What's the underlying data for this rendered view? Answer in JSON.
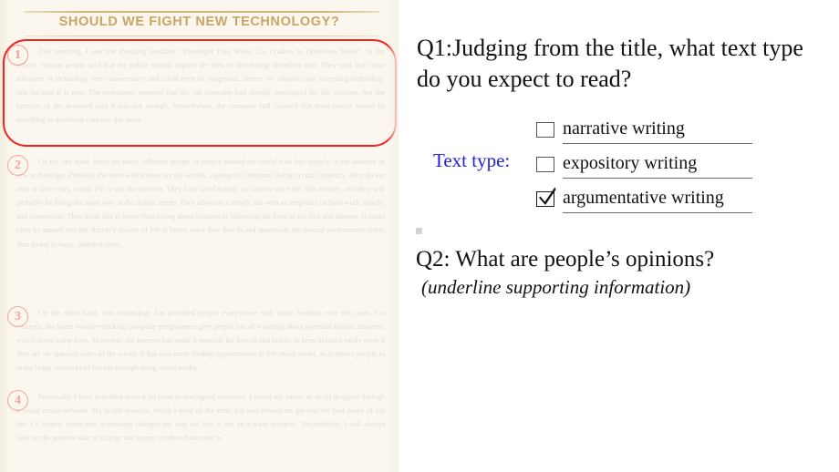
{
  "document": {
    "title": "SHOULD WE FIGHT NEW TECHNOLOGY?",
    "title_color": "#c9a566",
    "page_background": "#fbf7ee",
    "highlight_color": "#f4241c",
    "paragraph_number_color": "#f3a6a0",
    "paragraph_numbers": [
      "1",
      "2",
      "3",
      "4"
    ],
    "paragraphs": [
      {
        "number": "1",
        "highlighted": true,
        "text": "This morning, I saw the shocking headline: “Passenger Dies When Car Crashes in Driverless Mode”. In the article, various people said that the public should oppose the idea of developing driverless cars. They said that some advances in technology were unnecessary and could even be dangerous. Hence, we should cease accepting technology just because it is new. The newspaper reported that the car company had already apologised for the accident, but the families of the deceased said it was not enough. Nevertheless, the company still claimed that most people would be travelling in driverless cars one day soon."
      },
      {
        "number": "2",
        "highlighted": false,
        "text": "On the one hand, there are many different groups of people around the world who live happily in the absence of new technology. Probably the most well known are the Amish, a group of Christians living in rural America. They do not own or drive cars, watch TV, or use the Internet. They have lived mainly as farmers since the 18th century, and they will probably be living the same way in the distant future. They advocate a simple life with an emphasis on hard work, family, and community. They think that is better than caring about luxuries or following the lives of the rich and famous. It could even be argued that the Amish’s quality of life is better since they live in and appreciate the natural environment rather than living in large, polluted cities."
      },
      {
        "number": "3",
        "highlighted": false,
        "text": "On the other hand, new technology has provided people everywhere with many benefits over the years. For example, the latest weather-tracking computer programmes give people lots of warnings about potential natural disasters, which saves many lives. Moreover, the Internet has made it possible for friends and family to keep in touch easily even if they are on opposite sides of the world. It has also made finding opportunities in life much easier, as it allows people to make larger networks of friends through using social media."
      },
      {
        "number": "4",
        "highlighted": false,
        "text": "Personally, I have benefited quite a lot from technological advances. I found my career as an AI designer through a social media network. My health monitor, which I wear all the time, has also helped me get into the best shape of my life. Of course, when new technology changes the way we live, it can be a scary prospect. Nevertheless, I will always look on the positive side of change and accept it rather than resist it."
      }
    ]
  },
  "worksheet": {
    "q1": {
      "text": "Q1:Judging from the title, what text type do you expect to read?"
    },
    "text_type": {
      "label": "Text type:",
      "label_color": "#2222d8",
      "options": [
        {
          "label": "narrative writing",
          "checked": false
        },
        {
          "label": "expository writing",
          "checked": false
        },
        {
          "label": "argumentative writing",
          "checked": true
        }
      ]
    },
    "q2": {
      "text": "Q2: What are people’s opinions?",
      "hint": "(underline supporting information)"
    }
  }
}
